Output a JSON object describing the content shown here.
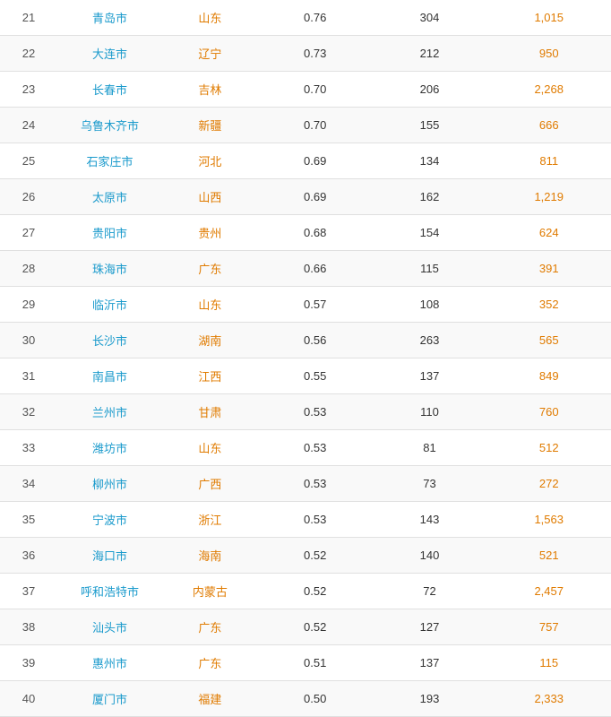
{
  "table": {
    "rows": [
      {
        "rank": 21,
        "city": "青岛市",
        "province": "山东",
        "val1": "0.76",
        "val2": "304",
        "val3": "1,015"
      },
      {
        "rank": 22,
        "city": "大连市",
        "province": "辽宁",
        "val1": "0.73",
        "val2": "212",
        "val3": "950"
      },
      {
        "rank": 23,
        "city": "长春市",
        "province": "吉林",
        "val1": "0.70",
        "val2": "206",
        "val3": "2,268"
      },
      {
        "rank": 24,
        "city": "乌鲁木齐市",
        "province": "新疆",
        "val1": "0.70",
        "val2": "155",
        "val3": "666"
      },
      {
        "rank": 25,
        "city": "石家庄市",
        "province": "河北",
        "val1": "0.69",
        "val2": "134",
        "val3": "811"
      },
      {
        "rank": 26,
        "city": "太原市",
        "province": "山西",
        "val1": "0.69",
        "val2": "162",
        "val3": "1,219"
      },
      {
        "rank": 27,
        "city": "贵阳市",
        "province": "贵州",
        "val1": "0.68",
        "val2": "154",
        "val3": "624"
      },
      {
        "rank": 28,
        "city": "珠海市",
        "province": "广东",
        "val1": "0.66",
        "val2": "115",
        "val3": "391"
      },
      {
        "rank": 29,
        "city": "临沂市",
        "province": "山东",
        "val1": "0.57",
        "val2": "108",
        "val3": "352"
      },
      {
        "rank": 30,
        "city": "长沙市",
        "province": "湖南",
        "val1": "0.56",
        "val2": "263",
        "val3": "565"
      },
      {
        "rank": 31,
        "city": "南昌市",
        "province": "江西",
        "val1": "0.55",
        "val2": "137",
        "val3": "849"
      },
      {
        "rank": 32,
        "city": "兰州市",
        "province": "甘肃",
        "val1": "0.53",
        "val2": "110",
        "val3": "760"
      },
      {
        "rank": 33,
        "city": "潍坊市",
        "province": "山东",
        "val1": "0.53",
        "val2": "81",
        "val3": "512"
      },
      {
        "rank": 34,
        "city": "柳州市",
        "province": "广西",
        "val1": "0.53",
        "val2": "73",
        "val3": "272"
      },
      {
        "rank": 35,
        "city": "宁波市",
        "province": "浙江",
        "val1": "0.53",
        "val2": "143",
        "val3": "1,563"
      },
      {
        "rank": 36,
        "city": "海口市",
        "province": "海南",
        "val1": "0.52",
        "val2": "140",
        "val3": "521"
      },
      {
        "rank": 37,
        "city": "呼和浩特市",
        "province": "内蒙古",
        "val1": "0.52",
        "val2": "72",
        "val3": "2,457"
      },
      {
        "rank": 38,
        "city": "汕头市",
        "province": "广东",
        "val1": "0.52",
        "val2": "127",
        "val3": "757"
      },
      {
        "rank": 39,
        "city": "惠州市",
        "province": "广东",
        "val1": "0.51",
        "val2": "137",
        "val3": "115"
      },
      {
        "rank": 40,
        "city": "厦门市",
        "province": "福建",
        "val1": "0.50",
        "val2": "193",
        "val3": "2,333"
      }
    ]
  }
}
